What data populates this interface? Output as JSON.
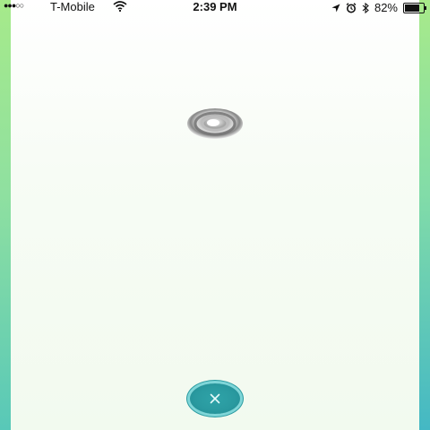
{
  "status_bar": {
    "signal_text": "●●●○○",
    "carrier": "T-Mobile",
    "time": "2:39 PM",
    "battery_percent": "82%",
    "battery_level": 0.82,
    "icons": [
      "wifi-icon",
      "location-arrow-icon",
      "alarm-icon",
      "bluetooth-icon",
      "battery-icon"
    ]
  },
  "main": {
    "spinner_icon": "pokestop-spinner-icon",
    "close_button_icon": "close-icon"
  },
  "colors": {
    "edge_green": "#a6ea8a",
    "edge_teal": "#44b8c4",
    "button_teal": "#2a9aa0",
    "button_ring": "#7fd6d8"
  }
}
